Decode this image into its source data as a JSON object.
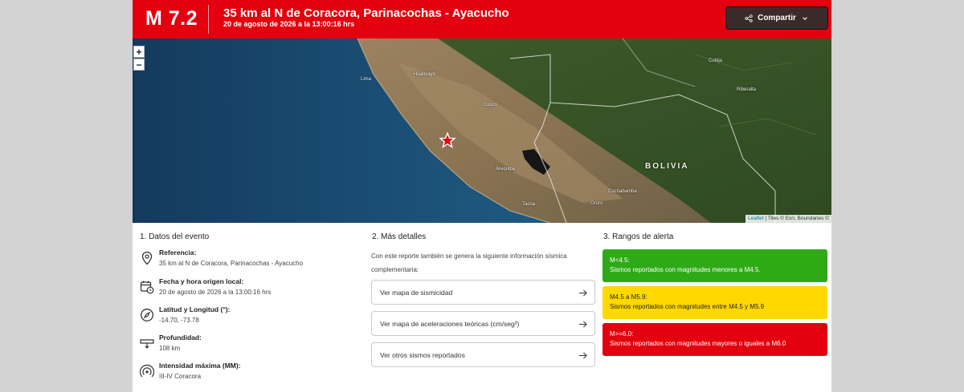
{
  "header": {
    "magnitude": "M 7.2",
    "title": "35 km al N de Coracora, Parinacochas - Ayacucho",
    "subtitle": "20 de agosto de 2026 a la 13:00:16 hrs",
    "share_label": "Compartir",
    "color": "#e3000f"
  },
  "map": {
    "zoom_in": "+",
    "zoom_out": "−",
    "labels": {
      "lima": "Lima",
      "huancayo": "Huancayo",
      "cusco": "Cusco",
      "arequipa": "Arequipa",
      "cochabamba": "Cochabamba",
      "tacna": "Tacna",
      "oruro": "Oruro",
      "cobija": "Cobija",
      "riberalta": "Riberalta",
      "bolivia": "BOLIVIA"
    },
    "attribution_leaflet": "Leaflet",
    "attribution_rest": "| Tiles © Esri, Boundaries ©",
    "epicenter_icon": "star-icon"
  },
  "event": {
    "title": "1. Datos del evento",
    "items": [
      {
        "icon": "location-pin-icon",
        "label": "Referencia:",
        "value": "35 km al N de Coracora, Parinacochas - Ayacucho"
      },
      {
        "icon": "calendar-clock-icon",
        "label": "Fecha y hora origen local:",
        "value": "20 de agosto de 2026 a la 13:00:16 hrs"
      },
      {
        "icon": "compass-icon",
        "label": "Latitud y Longitud (°):",
        "value": "-14.70, -73.78"
      },
      {
        "icon": "depth-icon",
        "label": "Profundidad:",
        "value": "108 km"
      },
      {
        "icon": "intensity-icon",
        "label": "Intensidad máxima (MM):",
        "value": "III-IV Coracora"
      }
    ]
  },
  "details": {
    "title": "2. Más detalles",
    "intro": "Con este reporte también se genera la siguiente información sísmica complementaria:",
    "buttons": [
      {
        "label": "Ver mapa de sismicidad"
      },
      {
        "label": "Ver mapa de aceleraciones teóricas (cm/seg²)"
      },
      {
        "label": "Ver otros sismos reportados"
      }
    ]
  },
  "alerts": {
    "title": "3. Rangos de alerta",
    "ranges": [
      {
        "range": "M<4.5:",
        "desc": "Sismos reportados con magnitudes menores a M4.5.",
        "color": "#2eaa17",
        "text_color": "#ffffff"
      },
      {
        "range": "M4.5 a M5.9:",
        "desc": "Sismos reportados con magnitudes entre M4.5 y M5.9",
        "color": "#ffd800",
        "text_color": "#222222"
      },
      {
        "range": "M>=6.0:",
        "desc": "Sismos reportados con magnitudes mayores o iguales a M6.0",
        "color": "#e3000f",
        "text_color": "#ffffff"
      }
    ]
  }
}
